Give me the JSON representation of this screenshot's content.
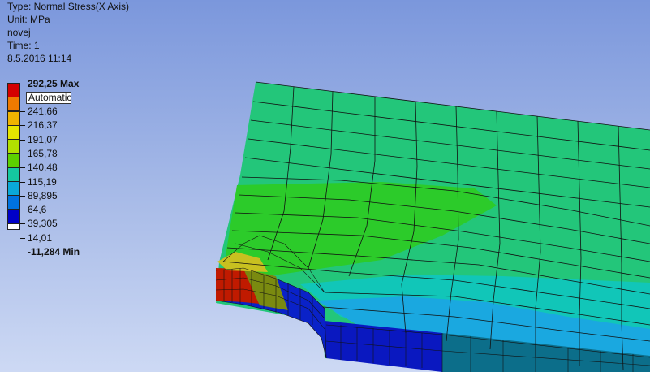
{
  "info": {
    "type": "Type: Normal Stress(X Axis)",
    "unit": "Unit: MPa",
    "name": "novej",
    "time": "Time: 1",
    "date": "8.5.2016 11:14"
  },
  "legend": {
    "max_label": "292,25 Max",
    "min_label": "-11,284 Min",
    "auto_field": "Automatic",
    "values": [
      "241,66",
      "216,37",
      "191,07",
      "165,78",
      "140,48",
      "115,19",
      "89,895",
      "64,6",
      "39,305",
      "14,01"
    ],
    "colors": [
      "#d40000",
      "#ef7a00",
      "#efb400",
      "#e6e600",
      "#b2e000",
      "#5cd000",
      "#15c8a0",
      "#0aa8d8",
      "#0072e0",
      "#0000c8",
      "#ffffff"
    ]
  }
}
